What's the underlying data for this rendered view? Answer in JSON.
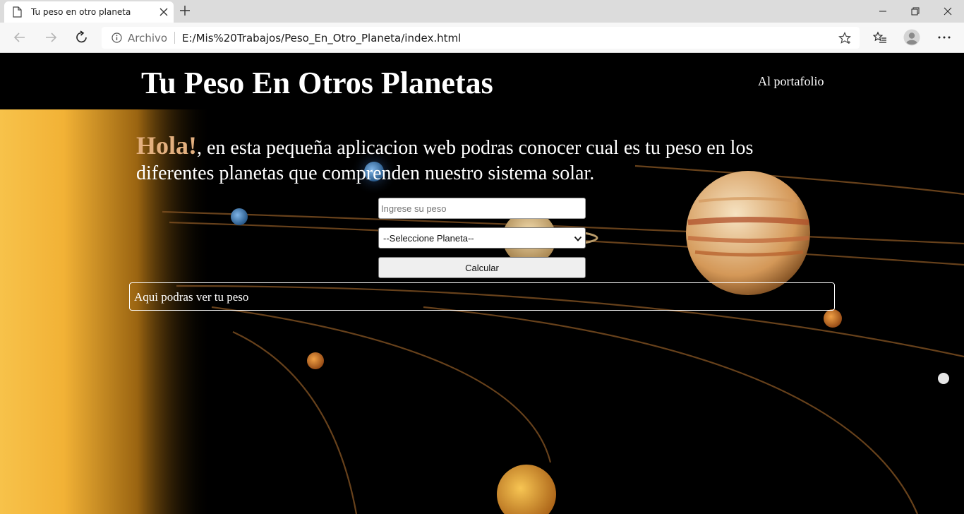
{
  "browser": {
    "tab_title": "Tu peso en otro planeta",
    "address": {
      "site_label": "Archivo",
      "url": "E:/Mis%20Trabajos/Peso_En_Otro_Planeta/index.html"
    },
    "icons": [
      "page-icon",
      "close-icon",
      "plus-icon",
      "minimize-icon",
      "maximize-icon",
      "close-icon",
      "back-arrow-icon",
      "forward-arrow-icon",
      "reload-icon",
      "info-icon",
      "star-icon",
      "favorites-icon",
      "profile-icon",
      "more-icon"
    ]
  },
  "site": {
    "title": "Tu Peso En Otros Planetas",
    "nav_link": "Al portafolio"
  },
  "intro": {
    "greeting": "Hola!",
    "text": ", en esta pequeña aplicacion web podras conocer cual es tu peso en los diferentes planetas que comprenden nuestro sistema solar."
  },
  "form": {
    "weight_placeholder": "Ingrese su peso",
    "planet_select_value": "--Seleccione Planeta--",
    "calculate_label": "Calcular"
  },
  "result": {
    "text": "Aqui podras ver tu peso"
  },
  "colors": {
    "background": "#000000",
    "greeting": "#e3b07f",
    "text": "#ffffff",
    "orbit": "#8a5a28",
    "sun": "#f2b236"
  }
}
